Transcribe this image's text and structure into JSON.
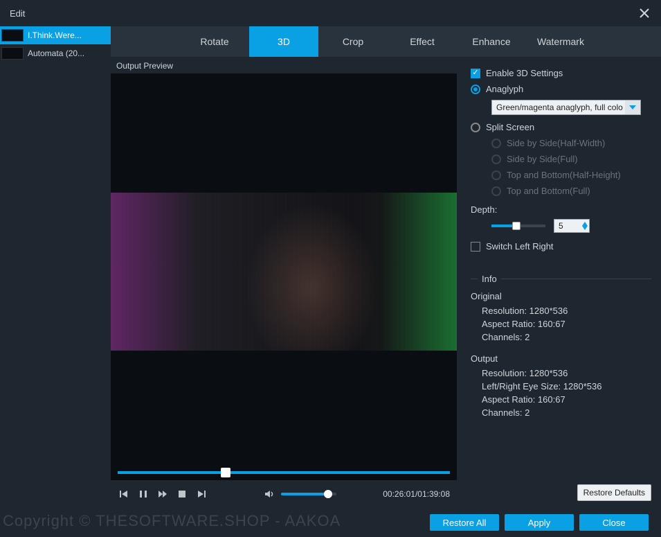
{
  "title": "Edit",
  "sidebar": {
    "items": [
      {
        "label": "I.Think.Were..."
      },
      {
        "label": "Automata (20..."
      }
    ]
  },
  "tabs": {
    "items": [
      "Rotate",
      "3D",
      "Crop",
      "Effect",
      "Enhance",
      "Watermark"
    ],
    "active": "3D"
  },
  "preview": {
    "label": "Output Preview",
    "time_current": "00:26:01",
    "time_total": "01:39:08"
  },
  "settings": {
    "enable_label": "Enable 3D Settings",
    "anaglyph_label": "Anaglyph",
    "anaglyph_select": "Green/magenta anaglyph, full colo",
    "split_label": "Split Screen",
    "split_options": [
      "Side by Side(Half-Width)",
      "Side by Side(Full)",
      "Top and Bottom(Half-Height)",
      "Top and Bottom(Full)"
    ],
    "depth_label": "Depth:",
    "depth_value": "5",
    "switch_label": "Switch Left Right",
    "info_head": "Info",
    "original_head": "Original",
    "original": {
      "resolution": "Resolution: 1280*536",
      "aspect": "Aspect Ratio: 160:67",
      "channels": "Channels: 2"
    },
    "output_head": "Output",
    "output": {
      "resolution": "Resolution: 1280*536",
      "eye": "Left/Right Eye Size: 1280*536",
      "aspect": "Aspect Ratio: 160:67",
      "channels": "Channels: 2"
    },
    "restore_defaults": "Restore Defaults"
  },
  "footer": {
    "restore_all": "Restore All",
    "apply": "Apply",
    "close": "Close"
  },
  "watermark_text": "Copyright ©   THESOFTWARE.SHOP - AAKOA"
}
